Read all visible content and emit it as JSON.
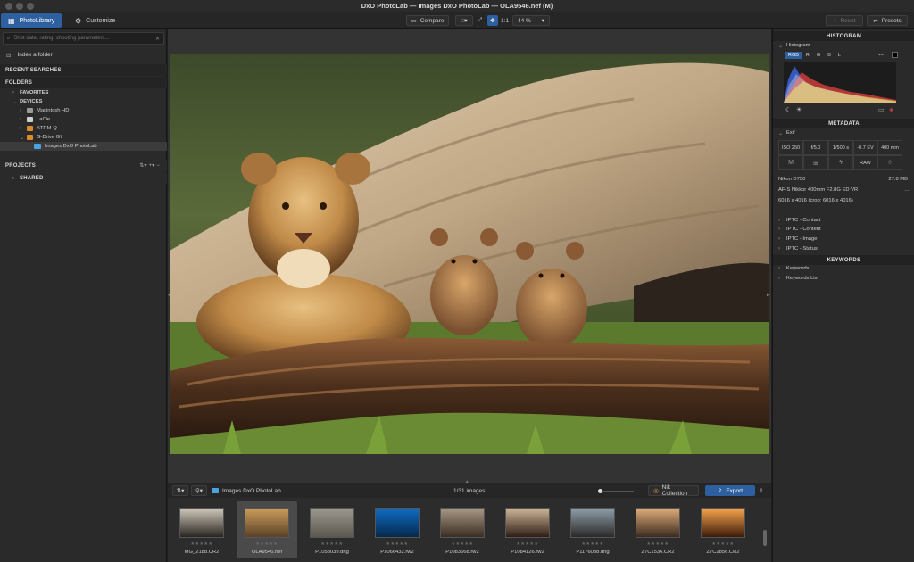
{
  "window": {
    "title": "DxO PhotoLab — Images DxO PhotoLab — OLA9546.nef (M)"
  },
  "toolbar": {
    "tabs": [
      {
        "label": "PhotoLibrary",
        "active": true
      },
      {
        "label": "Customize",
        "active": false
      }
    ],
    "compare_label": "Compare",
    "one_to_one_label": "1:1",
    "zoom_value": "44 %",
    "reset_label": "Reset",
    "presets_label": "Presets"
  },
  "left_panel": {
    "search_placeholder": "Shot date, rating, shooting parameters...",
    "index_label": "Index a folder",
    "recent_searches": "RECENT SEARCHES",
    "folders": "FOLDERS",
    "favorites": "FAVORITES",
    "devices": "DEVICES",
    "drives": [
      "Macintosh HD",
      "LaCie",
      "XTRM-Q",
      "G-Drive G7"
    ],
    "selected_folder": "Images DxO PhotoLab",
    "projects": "PROJECTS",
    "shared": "SHARED"
  },
  "filmstrip": {
    "folder_name": "Images DxO PhotoLab",
    "count": "1/31 images",
    "nik_label": "Nik Collection",
    "export_label": "Export",
    "stars": "★★★★★",
    "thumbs": [
      {
        "name": "MG_2188.CR2",
        "selected": false,
        "colors": [
          "#c9c3b6",
          "#2a2520"
        ]
      },
      {
        "name": "OLA9546.nef",
        "selected": true,
        "colors": [
          "#c89a58",
          "#5b4127"
        ]
      },
      {
        "name": "P1058039.dng",
        "selected": false,
        "colors": [
          "#9a958c",
          "#5c5850"
        ]
      },
      {
        "name": "P1066432.rw2",
        "selected": false,
        "colors": [
          "#0f6ac0",
          "#06294c"
        ]
      },
      {
        "name": "P1083668.rw2",
        "selected": false,
        "colors": [
          "#a49482",
          "#3a2d22"
        ]
      },
      {
        "name": "P1084126.rw2",
        "selected": false,
        "colors": [
          "#c9b093",
          "#2e1e15"
        ]
      },
      {
        "name": "P1176038.dng",
        "selected": false,
        "colors": [
          "#8b9aa5",
          "#2a2a28"
        ]
      },
      {
        "name": "Z7C1536.CR2",
        "selected": false,
        "colors": [
          "#d9a776",
          "#3c2b20"
        ]
      },
      {
        "name": "Z7C2856.CR2",
        "selected": false,
        "colors": [
          "#f0a04a",
          "#3d1b0a"
        ]
      }
    ]
  },
  "right_panel": {
    "histogram_header": "HISTOGRAM",
    "histogram_label": "Histogram",
    "channels": [
      "RGB",
      "R",
      "G",
      "B",
      "L"
    ],
    "metadata_header": "METADATA",
    "exif_label": "Exif",
    "exif_values": [
      "ISO 250",
      "f/5.0",
      "1/500 s",
      "-0.7 EV",
      "400 mm"
    ],
    "exif_flags": [
      "M",
      "RAW"
    ],
    "camera": "Nikon D750",
    "file_size": "27.8 MB",
    "lens": "AF-S Nikkor 400mm F2.8G ED VR",
    "dimensions": "6016 x 4016 (crop: 6016 x 4016)",
    "iptc": [
      "IPTC - Contact",
      "IPTC - Content",
      "IPTC - Image",
      "IPTC - Status"
    ],
    "keywords_header": "KEYWORDS",
    "keyword_items": [
      "Keywords",
      "Keywords List"
    ]
  }
}
